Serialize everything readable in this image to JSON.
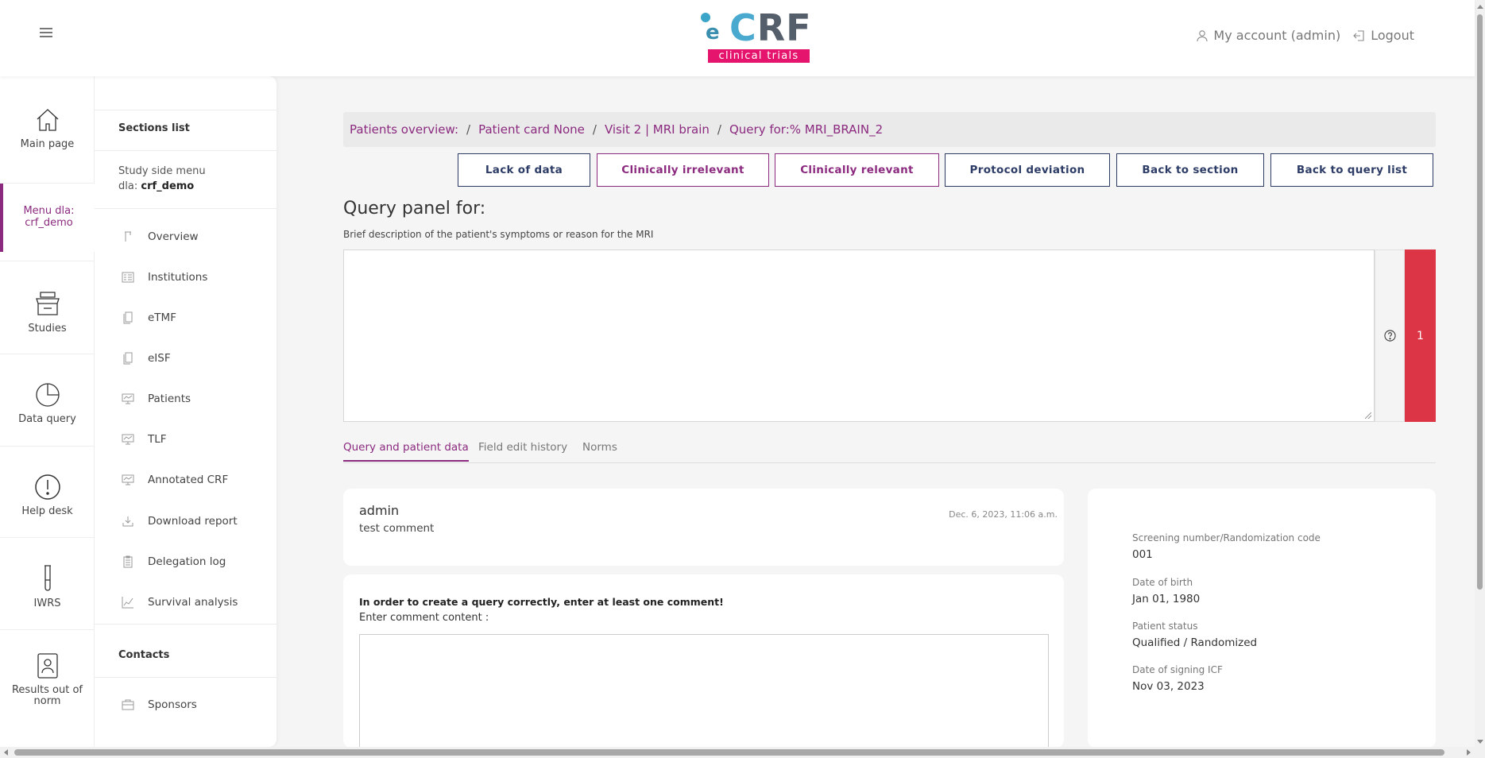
{
  "header": {
    "logo_e": "e",
    "logo_c": "C",
    "logo_rf": "RF",
    "logo_tagline": "clinical trials",
    "account_label": "My account (admin)",
    "logout_label": "Logout"
  },
  "rail": {
    "items": [
      {
        "label": "Main page",
        "icon": "home-icon"
      },
      {
        "label": "Menu dla: crf_demo",
        "icon": "none"
      },
      {
        "label": "Studies",
        "icon": "studies-icon"
      },
      {
        "label": "Data query",
        "icon": "pie-chart-icon"
      },
      {
        "label": "Help desk",
        "icon": "alert-circle-icon"
      },
      {
        "label": "IWRS",
        "icon": "test-tube-icon"
      },
      {
        "label": "Results out of norm",
        "icon": "person-clipboard-icon"
      }
    ]
  },
  "section_menu": {
    "title": "Sections list",
    "study_menu_label": "Study side menu",
    "study_prefix": "dla:",
    "study_name": "crf_demo",
    "items": [
      {
        "label": "Overview",
        "icon": "overview-icon"
      },
      {
        "label": "Institutions",
        "icon": "institutions-icon"
      },
      {
        "label": "eTMF",
        "icon": "document-icon"
      },
      {
        "label": "eISF",
        "icon": "document-icon"
      },
      {
        "label": "Patients",
        "icon": "monitor-icon"
      },
      {
        "label": "TLF",
        "icon": "monitor-icon"
      },
      {
        "label": "Annotated CRF",
        "icon": "monitor-icon"
      },
      {
        "label": "Download report",
        "icon": "download-icon"
      },
      {
        "label": "Delegation log",
        "icon": "clipboard-icon"
      },
      {
        "label": "Survival analysis",
        "icon": "line-chart-icon"
      }
    ],
    "contacts_title": "Contacts",
    "contacts_items": [
      {
        "label": "Sponsors",
        "icon": "briefcase-icon"
      }
    ]
  },
  "breadcrumb": {
    "items": [
      "Patients overview:",
      "Patient card None",
      "Visit 2 | MRI brain",
      "Query for:% MRI_BRAIN_2"
    ],
    "separator": "/"
  },
  "actions": {
    "lack_of_data": "Lack of data",
    "clinically_irrelevant": "Clinically irrelevant",
    "clinically_relevant": "Clinically relevant",
    "protocol_deviation": "Protocol deviation",
    "back_to_section": "Back to section",
    "back_to_query_list": "Back to query list"
  },
  "query_panel": {
    "title": "Query panel for:",
    "description": "Brief description of the patient's symptoms or reason for the MRI",
    "value": "",
    "count": "1"
  },
  "tabs": [
    {
      "label": "Query and patient data",
      "active": true
    },
    {
      "label": "Field edit history",
      "active": false
    },
    {
      "label": "Norms",
      "active": false
    }
  ],
  "comments": [
    {
      "user": "admin",
      "text": "test comment",
      "date": "Dec. 6, 2023, 11:06 a.m."
    }
  ],
  "new_comment": {
    "warning": "In order to create a query correctly, enter at least one comment!",
    "label": "Enter comment content :",
    "value": ""
  },
  "patient": {
    "fields": [
      {
        "label": "Screening number/Randomization code",
        "value": "001"
      },
      {
        "label": "Date of birth",
        "value": "Jan 01, 1980"
      },
      {
        "label": "Patient status",
        "value": "Qualified / Randomized"
      },
      {
        "label": "Date of signing ICF",
        "value": "Nov 03, 2023"
      }
    ]
  },
  "colors": {
    "accent": "#8b2a7f",
    "button_navy": "#2d3c66",
    "danger": "#dc3545",
    "logo_pink": "#e5156e",
    "logo_blue": "#4aa9cf"
  }
}
